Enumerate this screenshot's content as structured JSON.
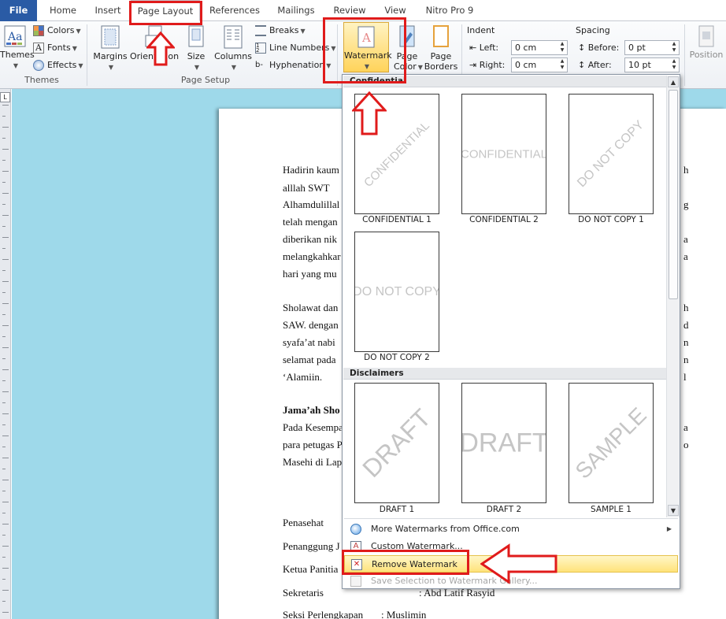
{
  "tabs": [
    "File",
    "Home",
    "Insert",
    "Page Layout",
    "References",
    "Mailings",
    "Review",
    "View",
    "Nitro Pro 9"
  ],
  "ribbon": {
    "themes": {
      "big": "Themes",
      "colors": "Colors",
      "fonts": "Fonts",
      "effects": "Effects",
      "group": "Themes"
    },
    "page_setup": {
      "margins": "Margins",
      "orientation": "Orientation",
      "size": "Size",
      "columns": "Columns",
      "breaks": "Breaks",
      "line_numbers": "Line Numbers",
      "hyphenation": "Hyphenation",
      "group": "Page Setup"
    },
    "page_background": {
      "watermark": "Watermark",
      "page_color_1": "Page",
      "page_color_2": "Color",
      "page_borders_1": "Page",
      "page_borders_2": "Borders"
    },
    "paragraph": {
      "indent": "Indent",
      "left_label": "Left:",
      "left_value": "0 cm",
      "right_label": "Right:",
      "right_value": "0 cm",
      "spacing": "Spacing",
      "before_label": "Before:",
      "before_value": "0 pt",
      "after_label": "After:",
      "after_value": "10 pt"
    },
    "arrange": {
      "position": "Position"
    }
  },
  "gallery": {
    "categories": [
      "Confidential",
      "Disclaimers"
    ],
    "items": [
      {
        "caption": "CONFIDENTIAL 1",
        "text": "CONFIDENTIAL"
      },
      {
        "caption": "CONFIDENTIAL 2",
        "text": "CONFIDENTIAL"
      },
      {
        "caption": "DO NOT COPY 1",
        "text": "DO NOT COPY"
      },
      {
        "caption": "DO NOT COPY 2",
        "text": "DO NOT COPY"
      },
      {
        "caption": "DRAFT 1",
        "text": "DRAFT"
      },
      {
        "caption": "DRAFT 2",
        "text": "DRAFT"
      },
      {
        "caption": "SAMPLE 1",
        "text": "SAMPLE"
      }
    ],
    "menu": {
      "more": "More Watermarks from Office.com",
      "custom": "Custom Watermark...",
      "remove": "Remove Watermark",
      "save": "Save Selection to Watermark Gallery..."
    }
  },
  "document": {
    "lines": [
      "Hadirin kaum",
      "alllah SWT",
      "Alhamdulillal",
      "telah mengan",
      "diberikan nik",
      "melangkahkar",
      "hari yang mu",
      "Sholawat dan",
      "SAW. dengan",
      "syafa’at nabi",
      "selamat pada",
      "‘Alamiin.",
      "Jama’ah Sho",
      "Pada Kesempa",
      "para petugas P",
      "Masehi di Lap",
      "Penasehat",
      "Penanggung J",
      "Ketua Panitia",
      "Sekretaris",
      "Seksi Perlengkapan"
    ],
    "right_fragments": [
      "h",
      "g",
      "a",
      "a",
      "h",
      "d",
      "n",
      "n",
      "l",
      "a",
      "o"
    ],
    "sekretaris_value": ": Abd Latif Rasyid",
    "perlengkapan_value": ": Muslimin"
  },
  "colors": {
    "file_tab": "#2a5ba5",
    "canvas": "#9ed9ea",
    "highlight_red": "#e01b1b",
    "menu_highlight": "#ffe37a"
  }
}
